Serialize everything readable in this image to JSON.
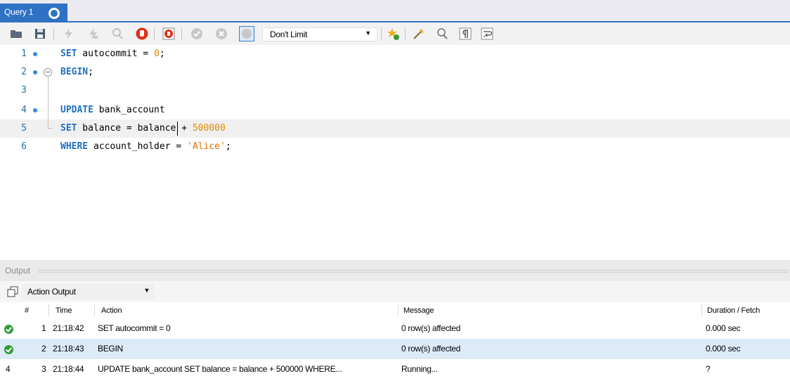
{
  "tab": {
    "title": "Query 1"
  },
  "toolbar": {
    "icons": [
      "open-folder-icon",
      "save-icon",
      "execute-icon",
      "execute-current-icon",
      "explain-icon",
      "stop-icon",
      "toggle-error-stop-icon",
      "commit-icon",
      "rollback-icon",
      "autocommit-icon",
      "add-snippet-icon",
      "beautify-icon",
      "find-icon",
      "invisible-chars-icon",
      "word-wrap-icon"
    ],
    "limit_value": "Don't Limit"
  },
  "editor": {
    "lines": [
      {
        "number": "1",
        "tokens": [
          [
            "kw",
            "SET"
          ],
          [
            "",
            " autocommit = "
          ],
          [
            "num",
            "0"
          ],
          [
            "",
            ";"
          ]
        ]
      },
      {
        "number": "2",
        "tokens": [
          [
            "kw",
            "BEGIN"
          ],
          [
            "",
            ";"
          ]
        ]
      },
      {
        "number": "3",
        "tokens": []
      },
      {
        "number": "4",
        "tokens": [
          [
            "kw",
            "UPDATE"
          ],
          [
            "",
            " bank_account"
          ]
        ]
      },
      {
        "number": "5",
        "tokens": [
          [
            "kw",
            "SET"
          ],
          [
            "",
            " balance = balance + "
          ],
          [
            "num",
            "500000"
          ]
        ]
      },
      {
        "number": "6",
        "tokens": [
          [
            "kw",
            "WHERE"
          ],
          [
            "",
            " account_holder = "
          ],
          [
            "str",
            "'Alice'"
          ],
          [
            "",
            ";"
          ]
        ]
      }
    ]
  },
  "output": {
    "title": "Output",
    "view_select": "Action Output",
    "columns": {
      "num": "#",
      "time": "Time",
      "action": "Action",
      "message": "Message",
      "duration": "Duration / Fetch"
    },
    "rows": [
      {
        "status": "ok",
        "num": "1",
        "time": "21:18:42",
        "action": "SET autocommit = 0",
        "message": "0 row(s) affected",
        "duration": "0.000 sec"
      },
      {
        "status": "ok",
        "num": "2",
        "time": "21:18:43",
        "action": "BEGIN",
        "message": "0 row(s) affected",
        "duration": "0.000 sec"
      },
      {
        "status": "running",
        "status_text": "4",
        "num": "3",
        "time": "21:18:44",
        "action": "UPDATE bank_account  SET balance = balance + 500000  WHERE...",
        "message": "Running...",
        "duration": "?"
      }
    ]
  },
  "colors": {
    "accent": "#2f72c4",
    "keyword": "#2070c0",
    "number": "#e08a00",
    "success": "#2e9f3c",
    "row_alt": "#ddeaf8"
  }
}
